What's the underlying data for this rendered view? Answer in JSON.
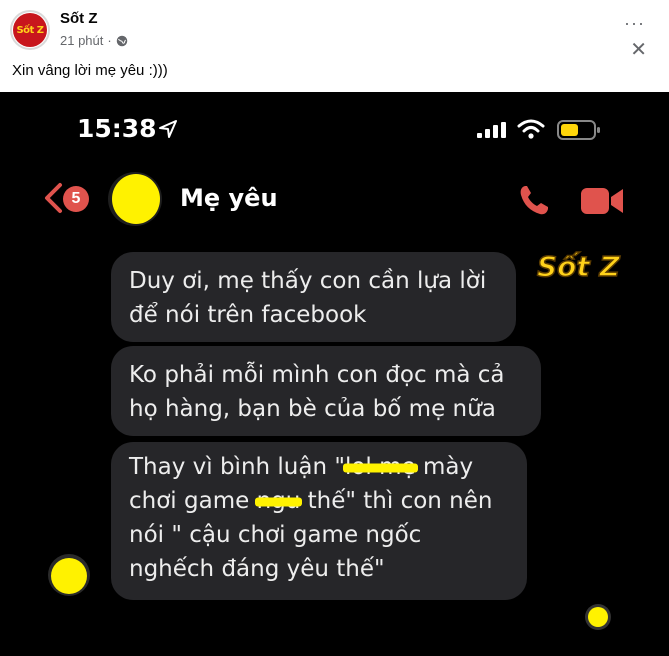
{
  "post": {
    "page_name": "Sốt Z",
    "page_logo_text": "Sốt Z",
    "time_ago": "21 phút",
    "more_label": "···",
    "close_label": "✕",
    "caption": "Xin vâng lời mẹ yêu :)))"
  },
  "phone": {
    "status_time": "15:38",
    "battery_color": "#ffd60a",
    "unread_count": "5",
    "contact_name": "Mẹ yêu",
    "accent_color": "#e0534d"
  },
  "watermark": {
    "text": "Sốt Z"
  },
  "messages": {
    "m1_line1": "Duy ơi, mẹ thấy con cần lựa lời",
    "m1_line2": "để nói trên facebook",
    "m2_line1": "Ko phải mỗi mình con đọc mà cả",
    "m2_line2": "họ hàng, bạn bè của bố mẹ nữa",
    "m3_line1_a": "Thay vì bình luận \"",
    "m3_line1_hl": "lol mẹ",
    "m3_line1_b": " mày",
    "m3_line2_a": "chơi game ",
    "m3_line2_hl": "ngu",
    "m3_line2_b": " thế\" thì con nên",
    "m3_line3": "nói \" cậu chơi game ngốc",
    "m3_line4": "nghếch đáng yêu thế\""
  }
}
